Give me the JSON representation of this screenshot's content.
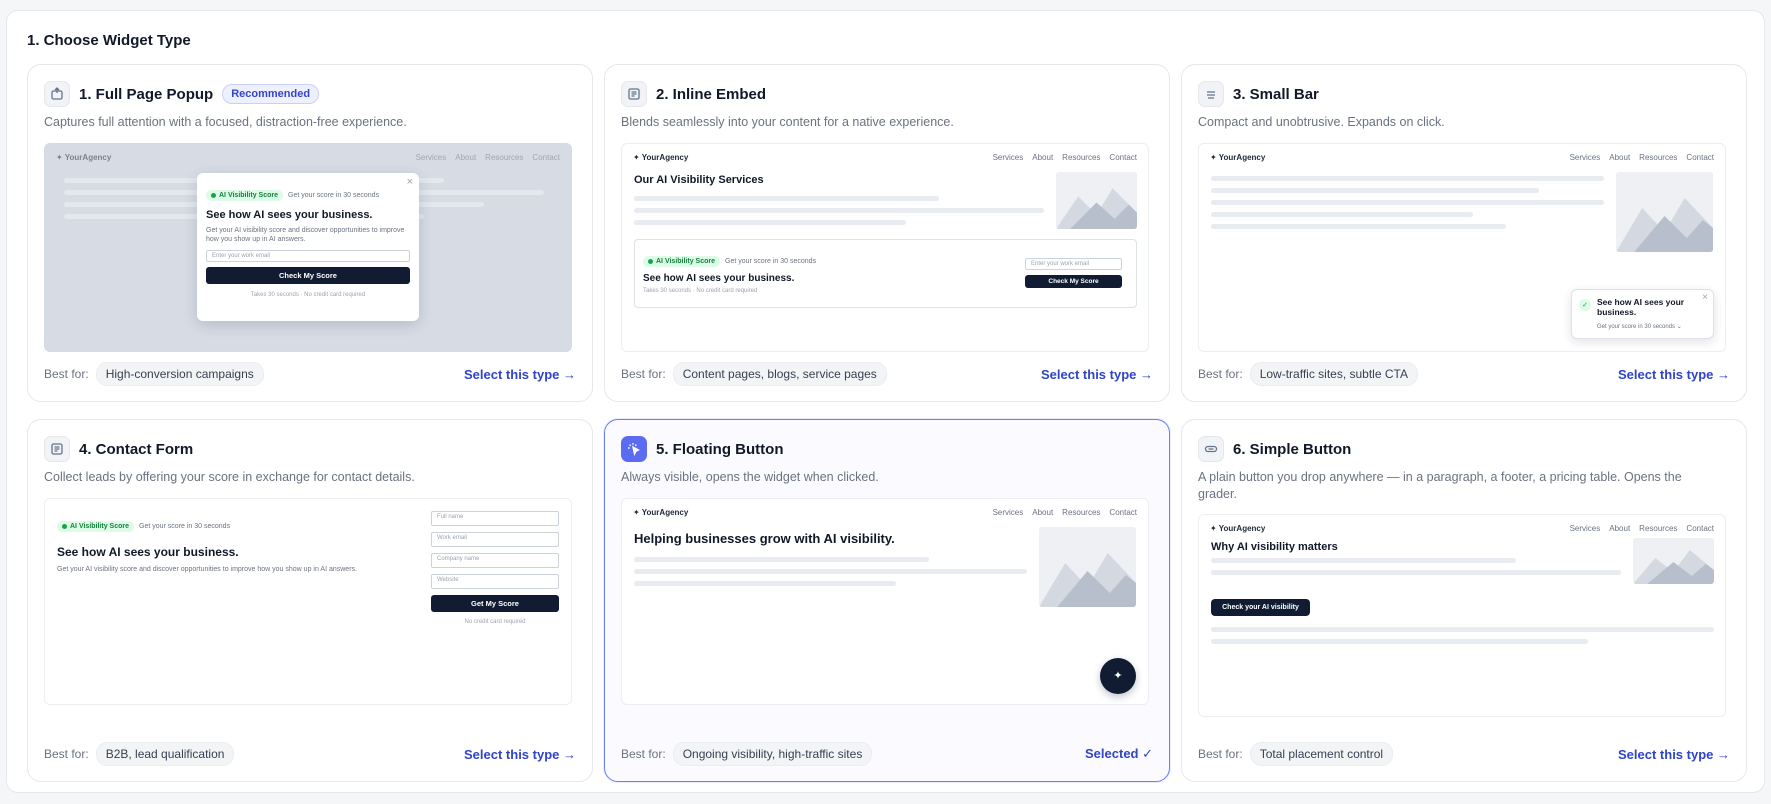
{
  "section_title": "1. Choose Widget Type",
  "mock": {
    "logo": "✦ YourAgency",
    "nav": [
      "Services",
      "About",
      "Resources",
      "Contact"
    ],
    "pill": "AI Visibility Score",
    "pill_sub": "Get your score in 30 seconds",
    "headline": "See how AI sees your business.",
    "body": "Get your AI visibility score and discover opportunities to improve how you show up in AI answers.",
    "email_placeholder": "Enter your work email",
    "check_score": "Check My Score",
    "fine_print": "Takes 30 seconds · No credit card required",
    "close": "×"
  },
  "cards": [
    {
      "title": "1. Full Page Popup",
      "badge": "Recommended",
      "desc": "Captures full attention with a focused, distraction-free experience.",
      "best_for_label": "Best for:",
      "best_for": "High-conversion campaigns",
      "action": "Select this type →"
    },
    {
      "title": "2. Inline Embed",
      "desc": "Blends seamlessly into your content for a native experience.",
      "best_for_label": "Best for:",
      "best_for": "Content pages, blogs, service pages",
      "action": "Select this type →",
      "preview": {
        "heading": "Our AI Visibility Services",
        "email_placeholder": "Enter your work email",
        "button": "Check My Score",
        "fine_print": "Takes 30 seconds · No credit card required"
      }
    },
    {
      "title": "3. Small Bar",
      "desc": "Compact and unobtrusive. Expands on click.",
      "best_for_label": "Best for:",
      "best_for": "Low-traffic sites, subtle CTA",
      "action": "Select this type →",
      "preview": {
        "bar_title": "See how AI sees your business.",
        "bar_sub": "Get your score in 30 seconds ⌄",
        "check": "✓",
        "close": "×"
      }
    },
    {
      "title": "4. Contact Form",
      "desc": "Collect leads by offering your score in exchange for contact details.",
      "best_for_label": "Best for:",
      "best_for": "B2B, lead qualification",
      "action": "Select this type →",
      "preview": {
        "fields": [
          "Full name",
          "Work email",
          "Company name",
          "Website"
        ],
        "button": "Get My Score",
        "fine_print": "No credit card required"
      }
    },
    {
      "title": "5. Floating Button",
      "desc": "Always visible, opens the widget when clicked.",
      "best_for_label": "Best for:",
      "best_for": "Ongoing visibility, high-traffic sites",
      "action": "Selected ✓",
      "preview": {
        "heading": "Helping businesses grow with AI visibility.",
        "fab": "✦"
      }
    },
    {
      "title": "6. Simple Button",
      "desc": "A plain button you drop anywhere — in a paragraph, a footer, a pricing table. Opens the grader.",
      "best_for_label": "Best for:",
      "best_for": "Total placement control",
      "action": "Select this type →",
      "preview": {
        "heading": "Why AI visibility matters",
        "button": "Check your AI visibility"
      }
    }
  ],
  "selected_index": 4,
  "colors": {
    "accent": "#2f44c7",
    "selected_border": "#6b7ff0",
    "dark": "#111c33",
    "green": "#16a34a"
  }
}
